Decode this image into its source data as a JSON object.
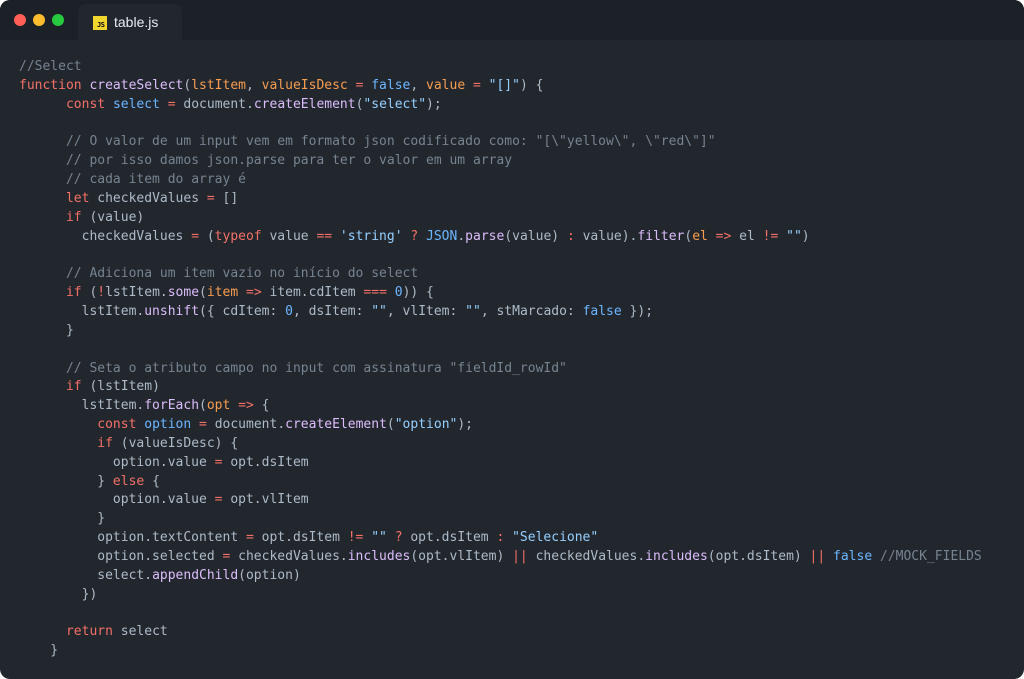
{
  "window": {
    "traffic_lights": [
      {
        "name": "close",
        "color": "#ff5f56"
      },
      {
        "name": "minimize",
        "color": "#ffbd2e"
      },
      {
        "name": "maximize",
        "color": "#27c93f"
      }
    ],
    "tab": {
      "badge": "JS",
      "filename": "table.js"
    }
  },
  "colors": {
    "default": "#adbac7",
    "comment": "#768390",
    "keyword": "#f47067",
    "function": "#dcbdfb",
    "string": "#96d0ff",
    "constant": "#6cb6ff",
    "param": "#f69d50"
  },
  "code_lines": [
    [
      [
        "c",
        "//Select"
      ]
    ],
    [
      [
        "k",
        "function "
      ],
      [
        "f",
        "createSelect"
      ],
      [
        "d",
        "("
      ],
      [
        "p",
        "lstItem"
      ],
      [
        "d",
        ", "
      ],
      [
        "p",
        "valueIsDesc"
      ],
      [
        "d",
        " "
      ],
      [
        "k",
        "="
      ],
      [
        "d",
        " "
      ],
      [
        "n",
        "false"
      ],
      [
        "d",
        ", "
      ],
      [
        "p",
        "value"
      ],
      [
        "d",
        " "
      ],
      [
        "k",
        "="
      ],
      [
        "d",
        " "
      ],
      [
        "s",
        "\"[]\""
      ],
      [
        "d",
        ") {"
      ]
    ],
    [
      [
        "d",
        "      "
      ],
      [
        "k",
        "const "
      ],
      [
        "n",
        "select"
      ],
      [
        "d",
        " "
      ],
      [
        "k",
        "="
      ],
      [
        "d",
        " document."
      ],
      [
        "f",
        "createElement"
      ],
      [
        "d",
        "("
      ],
      [
        "s",
        "\"select\""
      ],
      [
        "d",
        ");"
      ]
    ],
    [],
    [
      [
        "d",
        "      "
      ],
      [
        "c",
        "// O valor de um input vem em formato json codificado como: \"[\\\"yellow\\\", \\\"red\\\"]\""
      ]
    ],
    [
      [
        "d",
        "      "
      ],
      [
        "c",
        "// por isso damos json.parse para ter o valor em um array"
      ]
    ],
    [
      [
        "d",
        "      "
      ],
      [
        "c",
        "// cada item do array é"
      ]
    ],
    [
      [
        "d",
        "      "
      ],
      [
        "k",
        "let "
      ],
      [
        "d",
        "checkedValues "
      ],
      [
        "k",
        "="
      ],
      [
        "d",
        " []"
      ]
    ],
    [
      [
        "d",
        "      "
      ],
      [
        "k",
        "if "
      ],
      [
        "d",
        "(value)"
      ]
    ],
    [
      [
        "d",
        "        checkedValues "
      ],
      [
        "k",
        "="
      ],
      [
        "d",
        " ("
      ],
      [
        "k",
        "typeof "
      ],
      [
        "d",
        "value "
      ],
      [
        "k",
        "=="
      ],
      [
        "d",
        " "
      ],
      [
        "s",
        "'string'"
      ],
      [
        "d",
        " "
      ],
      [
        "k",
        "?"
      ],
      [
        "d",
        " "
      ],
      [
        "n",
        "JSON"
      ],
      [
        "d",
        "."
      ],
      [
        "f",
        "parse"
      ],
      [
        "d",
        "(value) "
      ],
      [
        "k",
        ":"
      ],
      [
        "d",
        " value)."
      ],
      [
        "f",
        "filter"
      ],
      [
        "d",
        "("
      ],
      [
        "p",
        "el"
      ],
      [
        "d",
        " "
      ],
      [
        "k",
        "=>"
      ],
      [
        "d",
        " el "
      ],
      [
        "k",
        "!="
      ],
      [
        "d",
        " "
      ],
      [
        "s",
        "\"\""
      ],
      [
        "d",
        ")"
      ]
    ],
    [],
    [
      [
        "d",
        "      "
      ],
      [
        "c",
        "// Adiciona um item vazio no início do select"
      ]
    ],
    [
      [
        "d",
        "      "
      ],
      [
        "k",
        "if "
      ],
      [
        "d",
        "("
      ],
      [
        "k",
        "!"
      ],
      [
        "d",
        "lstItem."
      ],
      [
        "f",
        "some"
      ],
      [
        "d",
        "("
      ],
      [
        "p",
        "item"
      ],
      [
        "d",
        " "
      ],
      [
        "k",
        "=>"
      ],
      [
        "d",
        " item.cdItem "
      ],
      [
        "k",
        "==="
      ],
      [
        "d",
        " "
      ],
      [
        "n",
        "0"
      ],
      [
        "d",
        ")) {"
      ]
    ],
    [
      [
        "d",
        "        lstItem."
      ],
      [
        "f",
        "unshift"
      ],
      [
        "d",
        "({ cdItem: "
      ],
      [
        "n",
        "0"
      ],
      [
        "d",
        ", dsItem: "
      ],
      [
        "s",
        "\"\""
      ],
      [
        "d",
        ", vlItem: "
      ],
      [
        "s",
        "\"\""
      ],
      [
        "d",
        ", stMarcado: "
      ],
      [
        "n",
        "false"
      ],
      [
        "d",
        " });"
      ]
    ],
    [
      [
        "d",
        "      }"
      ]
    ],
    [],
    [
      [
        "d",
        "      "
      ],
      [
        "c",
        "// Seta o atributo campo no input com assinatura \"fieldId_rowId\""
      ]
    ],
    [
      [
        "d",
        "      "
      ],
      [
        "k",
        "if "
      ],
      [
        "d",
        "(lstItem)"
      ]
    ],
    [
      [
        "d",
        "        lstItem."
      ],
      [
        "f",
        "forEach"
      ],
      [
        "d",
        "("
      ],
      [
        "p",
        "opt"
      ],
      [
        "d",
        " "
      ],
      [
        "k",
        "=>"
      ],
      [
        "d",
        " {"
      ]
    ],
    [
      [
        "d",
        "          "
      ],
      [
        "k",
        "const "
      ],
      [
        "n",
        "option"
      ],
      [
        "d",
        " "
      ],
      [
        "k",
        "="
      ],
      [
        "d",
        " document."
      ],
      [
        "f",
        "createElement"
      ],
      [
        "d",
        "("
      ],
      [
        "s",
        "\"option\""
      ],
      [
        "d",
        ");"
      ]
    ],
    [
      [
        "d",
        "          "
      ],
      [
        "k",
        "if "
      ],
      [
        "d",
        "(valueIsDesc) {"
      ]
    ],
    [
      [
        "d",
        "            option.value "
      ],
      [
        "k",
        "="
      ],
      [
        "d",
        " opt.dsItem"
      ]
    ],
    [
      [
        "d",
        "          } "
      ],
      [
        "k",
        "else "
      ],
      [
        "d",
        "{"
      ]
    ],
    [
      [
        "d",
        "            option.value "
      ],
      [
        "k",
        "="
      ],
      [
        "d",
        " opt.vlItem"
      ]
    ],
    [
      [
        "d",
        "          }"
      ]
    ],
    [
      [
        "d",
        "          option.textContent "
      ],
      [
        "k",
        "="
      ],
      [
        "d",
        " opt.dsItem "
      ],
      [
        "k",
        "!="
      ],
      [
        "d",
        " "
      ],
      [
        "s",
        "\"\""
      ],
      [
        "d",
        " "
      ],
      [
        "k",
        "?"
      ],
      [
        "d",
        " opt.dsItem "
      ],
      [
        "k",
        ":"
      ],
      [
        "d",
        " "
      ],
      [
        "s",
        "\"Selecione\""
      ]
    ],
    [
      [
        "d",
        "          option.selected "
      ],
      [
        "k",
        "="
      ],
      [
        "d",
        " checkedValues."
      ],
      [
        "f",
        "includes"
      ],
      [
        "d",
        "(opt.vlItem) "
      ],
      [
        "k",
        "||"
      ],
      [
        "d",
        " checkedValues."
      ],
      [
        "f",
        "includes"
      ],
      [
        "d",
        "(opt.dsItem) "
      ],
      [
        "k",
        "||"
      ],
      [
        "d",
        " "
      ],
      [
        "n",
        "false"
      ],
      [
        "d",
        " "
      ],
      [
        "c",
        "//MOCK_FIELDS"
      ]
    ],
    [
      [
        "d",
        "          select."
      ],
      [
        "f",
        "appendChild"
      ],
      [
        "d",
        "(option)"
      ]
    ],
    [
      [
        "d",
        "        })"
      ]
    ],
    [],
    [
      [
        "d",
        "      "
      ],
      [
        "k",
        "return "
      ],
      [
        "d",
        "select"
      ]
    ],
    [
      [
        "d",
        "    }"
      ]
    ]
  ]
}
